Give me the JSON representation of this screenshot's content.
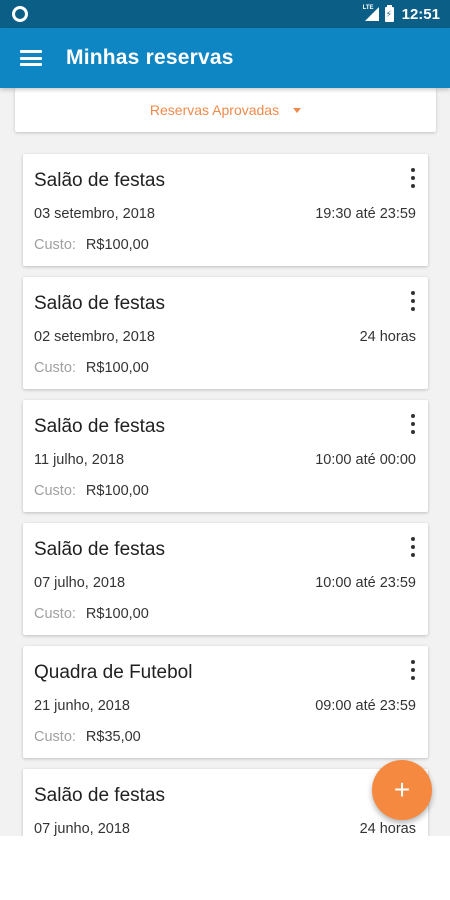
{
  "status_bar": {
    "time": "12:51",
    "network_label": "LTE",
    "battery_symbol": "⚡",
    "icons": [
      "circle-notification-icon",
      "signal-icon",
      "battery-icon"
    ]
  },
  "app_bar": {
    "title": "Minhas reservas",
    "menu_icon": "hamburger-menu-icon"
  },
  "filter": {
    "selected": "Reservas Aprovadas"
  },
  "reservations": [
    {
      "title": "Salão de festas",
      "date": "03 setembro, 2018",
      "time": "19:30 até 23:59",
      "cost_label": "Custo:",
      "cost_value": "R$100,00"
    },
    {
      "title": "Salão de festas",
      "date": "02 setembro, 2018",
      "time": "24 horas",
      "cost_label": "Custo:",
      "cost_value": "R$100,00"
    },
    {
      "title": "Salão de festas",
      "date": "11 julho, 2018",
      "time": "10:00 até 00:00",
      "cost_label": "Custo:",
      "cost_value": "R$100,00"
    },
    {
      "title": "Salão de festas",
      "date": "07 julho, 2018",
      "time": "10:00 até 23:59",
      "cost_label": "Custo:",
      "cost_value": "R$100,00"
    },
    {
      "title": "Quadra de Futebol",
      "date": "21 junho, 2018",
      "time": "09:00 até 23:59",
      "cost_label": "Custo:",
      "cost_value": "R$35,00"
    },
    {
      "title": "Salão de festas",
      "date": "07 junho, 2018",
      "time": "24 horas",
      "cost_label": "",
      "cost_value": ""
    }
  ],
  "fab": {
    "symbol": "+"
  },
  "colors": {
    "status_bar": "#0b5f86",
    "app_bar": "#0f86c4",
    "accent": "#f5893f",
    "filter_text": "#f08a4b",
    "background": "#f2f2f2"
  }
}
